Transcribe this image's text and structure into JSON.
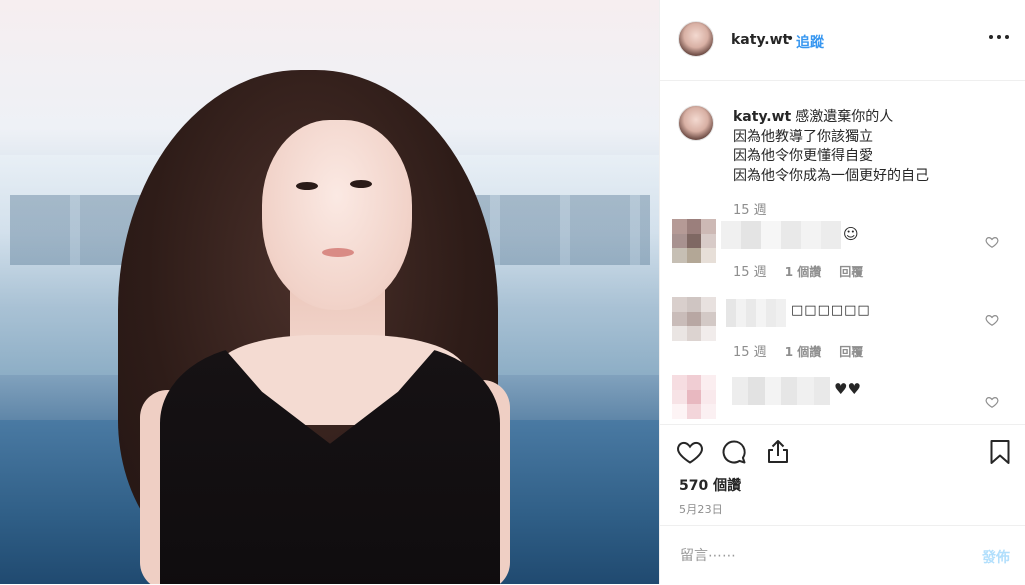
{
  "post": {
    "username": "katy.wt",
    "separator": "•",
    "follow_label": "追蹤",
    "more_icon": "more-horizontal-icon"
  },
  "caption": {
    "username": "katy.wt",
    "lines": [
      "感激遺棄你的人",
      "因為他教導了你該獨立",
      "因為他令你更懂得自愛",
      "因為他令你成為一個更好的自己"
    ],
    "time": "15 週"
  },
  "comments": [
    {
      "emoji": "☺",
      "time": "15 週",
      "likes_label": "1 個讚",
      "reply_label": "回覆"
    },
    {
      "emoji": "□□□□□□",
      "time": "15 週",
      "likes_label": "1 個讚",
      "reply_label": "回覆"
    },
    {
      "emoji": "♥♥"
    }
  ],
  "actions": {
    "like_icon": "heart-icon",
    "comment_icon": "comment-icon",
    "share_icon": "share-icon",
    "save_icon": "bookmark-icon",
    "likes_text": "570 個讚",
    "date": "5月23日"
  },
  "composer": {
    "placeholder": "留言⋯⋯",
    "post_label": "發佈"
  },
  "colors": {
    "link_blue": "#3897f0",
    "post_disabled": "#b2dffc",
    "meta_gray": "#8e8e8e",
    "text": "#262626"
  }
}
